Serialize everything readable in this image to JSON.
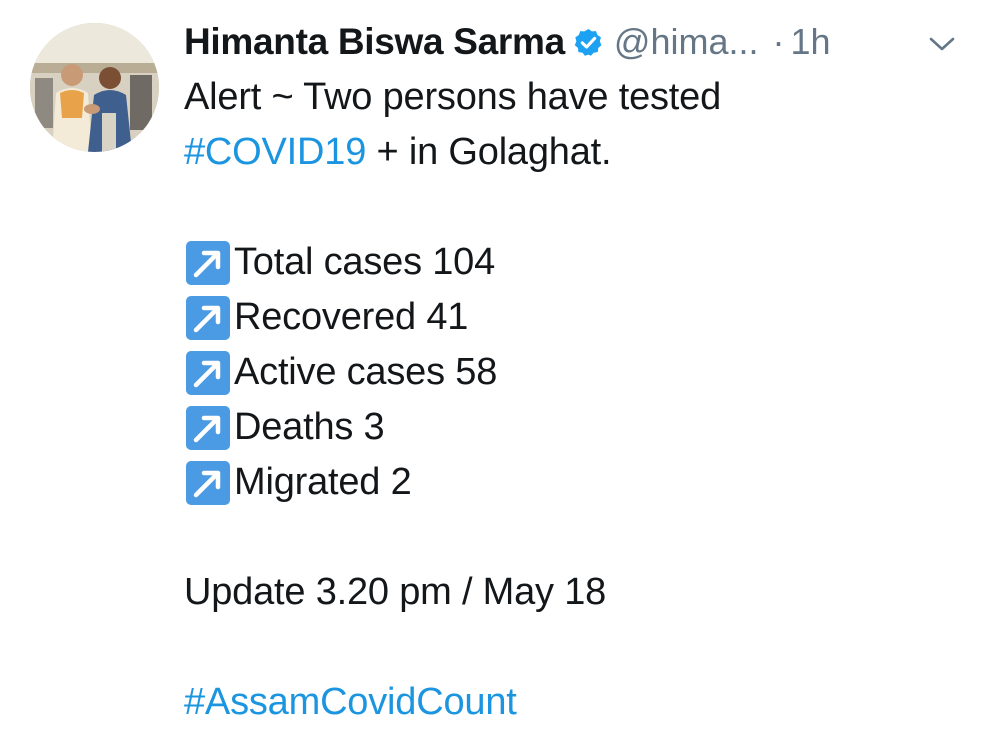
{
  "tweet": {
    "author_name": "Himanta Biswa Sarma",
    "handle": "@hima...",
    "separator": "·",
    "time": "1h",
    "line1": "Alert ~ Two persons have tested",
    "hashtag_covid": "#COVID19",
    "line2_rest": " + in Golaghat.",
    "stats": [
      {
        "label": "Total cases 104"
      },
      {
        "label": "Recovered 41"
      },
      {
        "label": "Active cases 58"
      },
      {
        "label": "Deaths 3"
      },
      {
        "label": "Migrated 2"
      }
    ],
    "update": "Update 3.20 pm / May 18",
    "hashtag_count": "#AssamCovidCount"
  },
  "icons": {
    "verified": "verified-badge-icon",
    "menu": "chevron-down-icon",
    "stat_emoji": "up-right-arrow-emoji-icon"
  },
  "colors": {
    "link": "#1b95e0",
    "text": "#14171a",
    "secondary": "#657786",
    "verified": "#1da1f2",
    "emoji_bg": "#4a9be3"
  }
}
